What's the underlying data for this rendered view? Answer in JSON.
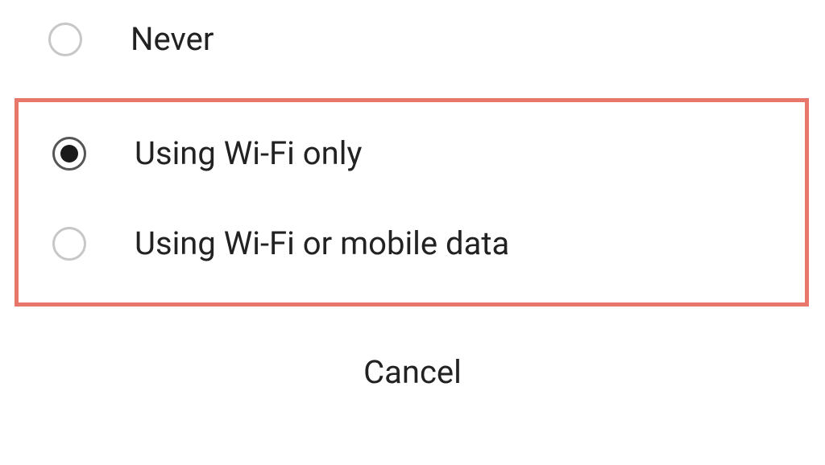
{
  "options": [
    {
      "label": "Never",
      "selected": false
    },
    {
      "label": "Using Wi-Fi only",
      "selected": true
    },
    {
      "label": "Using Wi-Fi or mobile data",
      "selected": false
    }
  ],
  "cancel_label": "Cancel",
  "highlight_color": "#e8766b"
}
